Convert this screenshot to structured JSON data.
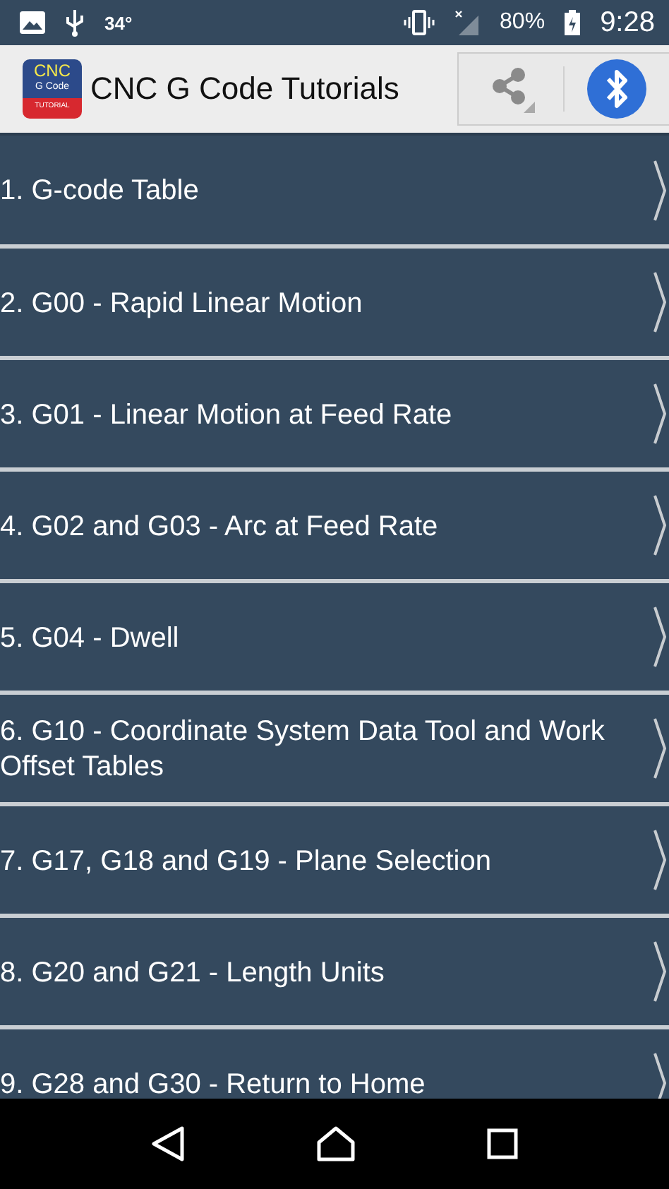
{
  "status_bar": {
    "temperature": "34°",
    "battery": "80%",
    "time": "9:28"
  },
  "app_bar": {
    "logo": {
      "line_1": "CNC",
      "line_2": "G Code",
      "line_3": "TUTORIAL"
    },
    "title": "CNC G Code Tutorials"
  },
  "items": [
    {
      "label": "1. G-code Table"
    },
    {
      "label": "2. G00 - Rapid Linear Motion"
    },
    {
      "label": "3. G01 - Linear Motion at Feed Rate"
    },
    {
      "label": "4. G02 and G03 - Arc at Feed Rate"
    },
    {
      "label": "5. G04 - Dwell"
    },
    {
      "label": "6. G10 - Coordinate System Data Tool and Work Offset Tables"
    },
    {
      "label": "7. G17, G18 and G19 - Plane Selection"
    },
    {
      "label": "8. G20 and G21 - Length Units"
    },
    {
      "label": "9. G28 and G30 - Return to Home"
    }
  ]
}
